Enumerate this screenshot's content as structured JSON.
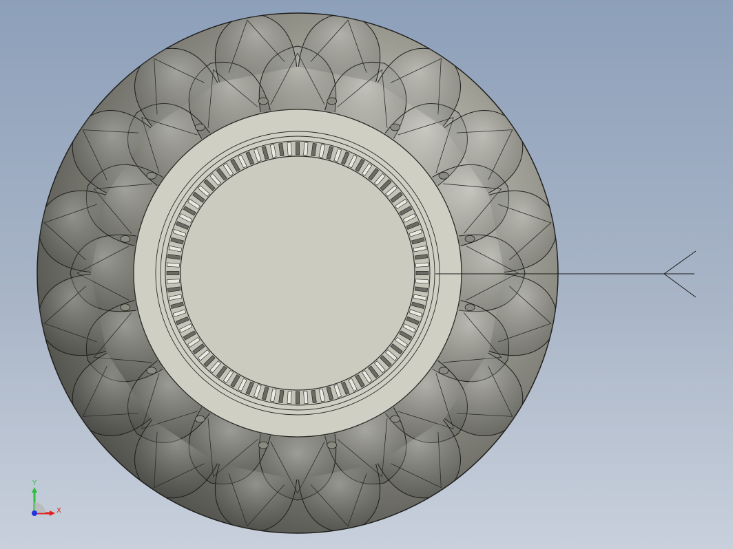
{
  "viewport": {
    "background_top": "#8da0ba",
    "background_bottom": "#c8d0dc"
  },
  "model": {
    "body_color": "#8e8e84",
    "face_color": "#cfcfc4",
    "edge_color": "#1e1f1c",
    "shape": "ornamental sphere with circular face and gear-tooth ring"
  },
  "triad": {
    "x_label": "X",
    "y_label": "Y",
    "x_color": "#e0201c",
    "y_color": "#2fbf3a",
    "z_color": "#2233e0"
  }
}
